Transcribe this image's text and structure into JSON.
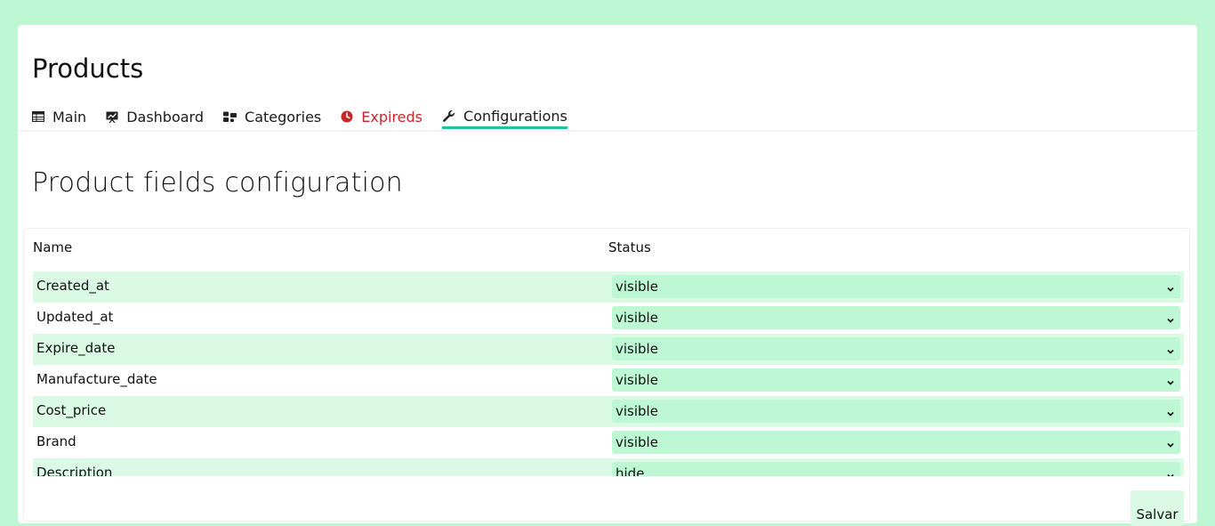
{
  "header": {
    "title": "Products"
  },
  "tabs": [
    {
      "label": "Main",
      "icon": "table-icon"
    },
    {
      "label": "Dashboard",
      "icon": "chart-board-icon"
    },
    {
      "label": "Categories",
      "icon": "categories-icon"
    },
    {
      "label": "Expireds",
      "icon": "clock-icon"
    },
    {
      "label": "Configurations",
      "icon": "wrench-icon"
    }
  ],
  "colors": {
    "background": "#bdf7d4",
    "accent": "#1dc5a0",
    "expired": "#c62828",
    "row_shade": "#dbfae6"
  },
  "section": {
    "title": "Product fields configuration"
  },
  "table": {
    "headers": {
      "name": "Name",
      "status": "Status"
    },
    "rows": [
      {
        "name": "Created_at",
        "status": "visible"
      },
      {
        "name": "Updated_at",
        "status": "visible"
      },
      {
        "name": "Expire_date",
        "status": "visible"
      },
      {
        "name": "Manufacture_date",
        "status": "visible"
      },
      {
        "name": "Cost_price",
        "status": "visible"
      },
      {
        "name": "Brand",
        "status": "visible"
      },
      {
        "name": "Description",
        "status": "hide"
      }
    ]
  },
  "actions": {
    "save_label": "Salvar"
  }
}
